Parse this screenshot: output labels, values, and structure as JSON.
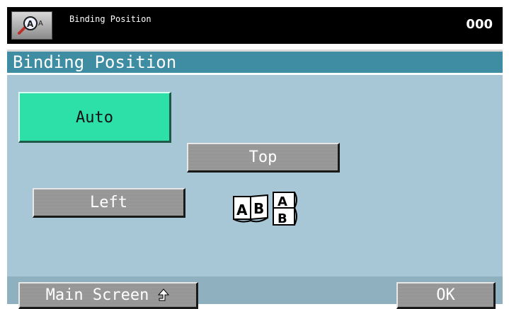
{
  "header": {
    "title": "Binding Position",
    "counter": "000",
    "app_icon": "magnifier-text-size-icon"
  },
  "dialog": {
    "title": "Binding Position",
    "options": [
      {
        "label": "Auto",
        "selected": true
      },
      {
        "label": "Top",
        "selected": false
      },
      {
        "label": "Left",
        "selected": false
      }
    ],
    "binding_icon": {
      "left_letters": [
        "A",
        "B"
      ],
      "top_letters": [
        "A",
        "B"
      ]
    }
  },
  "footer": {
    "main_screen_label": "Main Screen",
    "ok_label": "OK"
  },
  "colors": {
    "selected": "#2de0a8",
    "titlebar": "#3f8da3",
    "panel": "#a8c7d6"
  }
}
